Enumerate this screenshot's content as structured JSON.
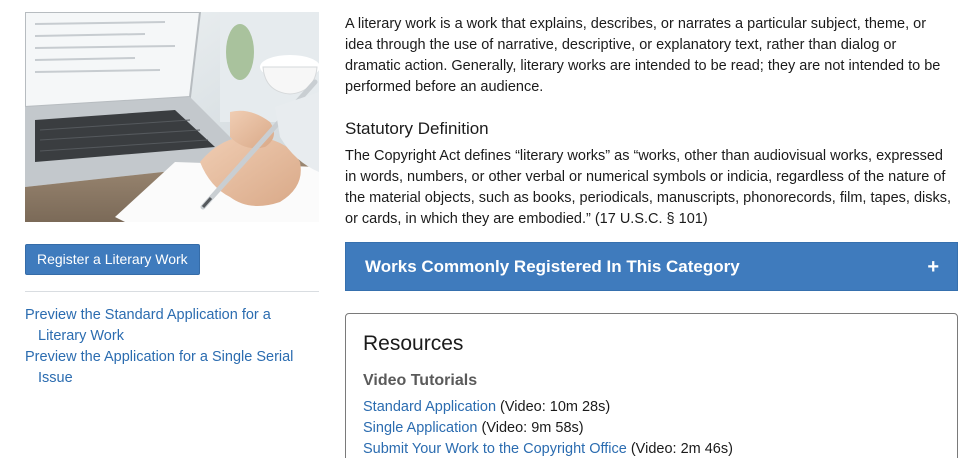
{
  "left": {
    "register_button": "Register a Literary Work",
    "preview_links": [
      "Preview the Standard Application for a Literary Work",
      "Preview the Application for a Single Serial Issue"
    ]
  },
  "main": {
    "intro": "A literary work is a work that explains, describes, or narrates a particular subject, theme, or idea through the use of narrative, descriptive, or explanatory text, rather than dialog or dramatic action. Generally, literary works are intended to be read; they are not intended to be performed before an audience.",
    "statutory_heading": "Statutory Definition",
    "statutory_text": "The Copyright Act defines “literary works” as “works, other than audiovisual works, expressed in words, numbers, or other verbal or numerical symbols or indicia, regardless of the nature of the material objects, such as books, periodicals, manuscripts, phonorecords, film, tapes, disks, or cards, in which they are embodied.” (17 U.S.C. § 101)",
    "accordion": {
      "title": "Works Commonly Registered In This Category",
      "icon": "+"
    },
    "resources": {
      "title": "Resources",
      "subtitle": "Video Tutorials",
      "items": [
        {
          "link": "Standard Application",
          "note": " (Video: 10m 28s)"
        },
        {
          "link": "Single Application",
          "note": " (Video: 9m 58s)"
        },
        {
          "link": "Submit Your Work to the Copyright Office",
          "note": " (Video: 2m 46s)"
        }
      ]
    }
  },
  "colors": {
    "accent": "#3f7bbd",
    "link": "#2b6cb0"
  }
}
